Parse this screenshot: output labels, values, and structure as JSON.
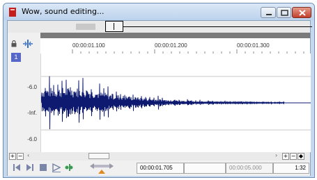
{
  "window": {
    "title": "Wow, sound editing...",
    "accent_color": "#c41e1e"
  },
  "track": {
    "number": "1",
    "level_labels": [
      "-6.0",
      "-Inf.",
      "-6.0"
    ],
    "wave_color": "#0d1a70"
  },
  "ruler": {
    "labels": [
      "00:00:01.100",
      "00:00:01.200",
      "00:00:01.300"
    ]
  },
  "transport": {
    "cursor_time": "00:00:01.705",
    "selection_start": "",
    "length_time": "00:00:05.000",
    "zoom": "1:32"
  },
  "icons": {
    "lock": "lock-icon",
    "snap": "snap-icon",
    "go_start": "go-to-start-icon",
    "go_end": "go-to-end-icon",
    "stop": "stop-icon",
    "play": "play-icon",
    "loop": "loop-icon",
    "scrub": "scrub-icon"
  }
}
